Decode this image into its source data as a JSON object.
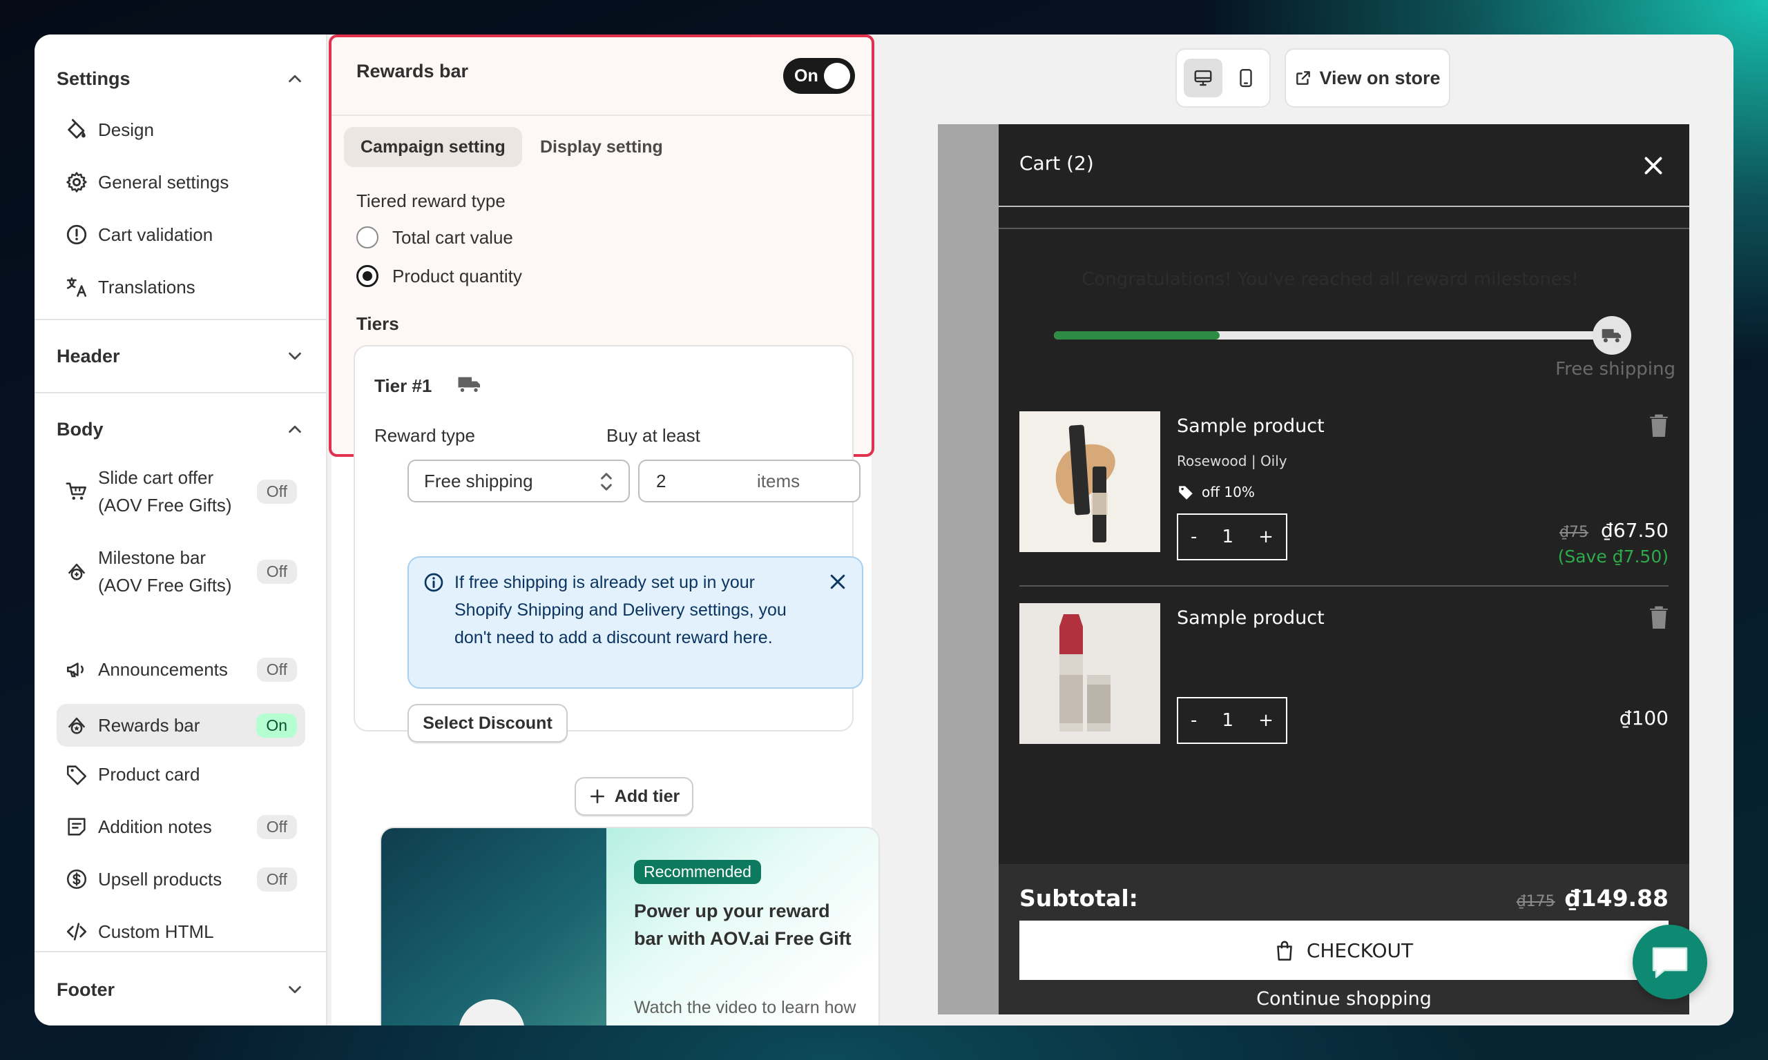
{
  "colors": {
    "accent_red": "#e0314f",
    "on_badge_bg": "#b4fed2",
    "progress_green": "#2e8b45",
    "save_green": "#2eaa4b",
    "chat_teal": "#0f8a72"
  },
  "sidebar": {
    "settings": {
      "title": "Settings",
      "icon": "chevron-up-icon",
      "items": [
        {
          "label": "Design",
          "icon": "paint-bucket-icon"
        },
        {
          "label": "General settings",
          "icon": "gear-icon"
        },
        {
          "label": "Cart validation",
          "icon": "alert-circle-icon"
        },
        {
          "label": "Translations",
          "icon": "translate-icon"
        }
      ]
    },
    "header": {
      "title": "Header",
      "icon": "chevron-down-icon"
    },
    "body": {
      "title": "Body",
      "icon": "chevron-up-icon",
      "items": [
        {
          "label": "Slide cart offer\n(AOV Free Gifts)",
          "badge": "Off",
          "icon": "cart-gift-icon"
        },
        {
          "label": "Milestone bar\n(AOV Free Gifts)",
          "badge": "Off",
          "icon": "milestone-icon"
        },
        {
          "label": "Announcements",
          "badge": "Off",
          "icon": "megaphone-icon"
        },
        {
          "label": "Rewards bar",
          "badge": "On",
          "icon": "rewards-icon"
        },
        {
          "label": "Product card",
          "badge": "",
          "icon": "tag-icon"
        },
        {
          "label": "Addition notes",
          "badge": "Off",
          "icon": "note-icon"
        },
        {
          "label": "Upsell products",
          "badge": "Off",
          "icon": "dollar-circle-icon"
        },
        {
          "label": "Custom HTML",
          "badge": "",
          "icon": "code-icon"
        }
      ]
    },
    "footer": {
      "title": "Footer",
      "icon": "chevron-down-icon"
    }
  },
  "panel": {
    "title": "Rewards bar",
    "toggle_label": "On",
    "tabs": [
      "Campaign setting",
      "Display setting"
    ],
    "active_tab": "Campaign setting",
    "tiered_reward_type_label": "Tiered reward type",
    "options": [
      "Total cart value",
      "Product quantity"
    ],
    "selected_option": "Product quantity",
    "tiers_label": "Tiers",
    "tier": {
      "title": "Tier #1",
      "icon": "truck-icon",
      "reward_type_label": "Reward type",
      "buy_at_least_label": "Buy at least",
      "reward_type_value": "Free shipping",
      "quantity_value": "2",
      "quantity_suffix": "items",
      "info_text": "If free shipping is already set up in your Shopify Shipping and Delivery settings, you don't need to add a discount reward here.",
      "select_discount_label": "Select Discount"
    },
    "add_tier_label": "Add tier",
    "promo": {
      "badge": "Recommended",
      "title": "Power up your reward bar with AOV.ai Free Gift",
      "description": "Watch the video to learn how AOV.ai Free Gift turns gifts into"
    }
  },
  "preview": {
    "view_on_store": "View on store",
    "devices": [
      "desktop-icon",
      "mobile-icon"
    ],
    "active_device": "desktop-icon",
    "cart": {
      "title": "Cart (2)",
      "congrats": "Congratulations! You've reached all reward milestones!",
      "progress_fraction": 0.3,
      "milestone_label": "Free shipping",
      "items": [
        {
          "name": "Sample product",
          "variant": "Rosewood | Oily",
          "discount": "off 10%",
          "quantity": "1",
          "old_price": "₫75",
          "price": "₫67.50",
          "save": "(Save ₫7.50)"
        },
        {
          "name": "Sample product",
          "quantity": "1",
          "price": "₫100"
        }
      ],
      "qty_minus": "-",
      "qty_plus": "+",
      "subtotal_label": "Subtotal:",
      "subtotal_old": "₫175",
      "subtotal": "₫149.88",
      "checkout_label": "CHECKOUT",
      "continue_label": "Continue shopping"
    }
  }
}
